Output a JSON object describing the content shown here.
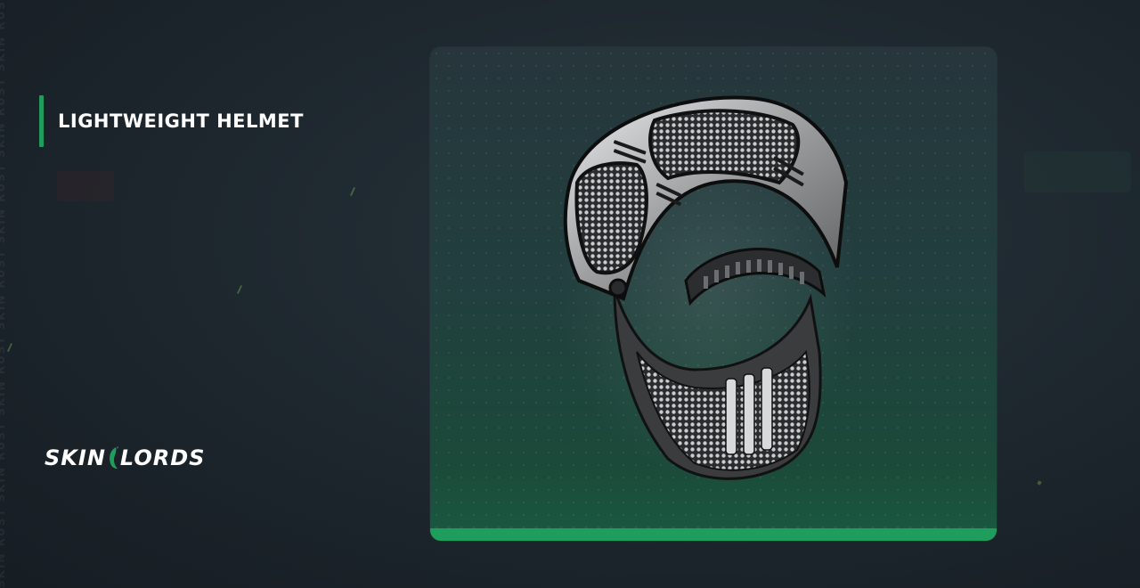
{
  "item": {
    "name": "LIGHTWEIGHT HELMET",
    "image_icon": "lightweight-helmet-icon"
  },
  "brand": {
    "logo_text_left": "SKIN",
    "logo_text_right": "LORDS",
    "watermark": "SKIN RUST SKIN RUST SKIN RUST SKIN RUST SKIN RUST SKIN RUST SKIN RUST SKIN RUST SKIN RUST SKIN RUST"
  },
  "colors": {
    "accent": "#1f9d5c",
    "background": "#1d262d",
    "text": "#ffffff"
  }
}
